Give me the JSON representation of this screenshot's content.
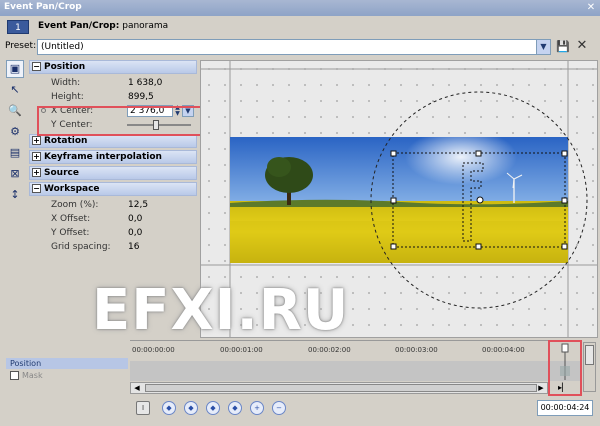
{
  "window": {
    "title": "Event Pan/Crop",
    "close_glyph": "✕"
  },
  "header": {
    "event_number": "1",
    "title_bold": "Event Pan/Crop:",
    "title_rest": "panorama"
  },
  "preset": {
    "label": "Preset:",
    "value": "(Untitled)"
  },
  "tools": [
    {
      "name": "properties-icon",
      "glyph": "▣"
    },
    {
      "name": "pointer-icon",
      "glyph": "↖"
    },
    {
      "name": "zoom-icon",
      "glyph": "🔍"
    },
    {
      "name": "normal-edit-icon",
      "glyph": "⚙"
    },
    {
      "name": "center-icon",
      "glyph": "▤"
    },
    {
      "name": "mirror-icon",
      "glyph": "⊠"
    },
    {
      "name": "move-vertical-icon",
      "glyph": "↕"
    }
  ],
  "properties": {
    "position": {
      "title": "Position",
      "width_label": "Width:",
      "width_value": "1 638,0",
      "height_label": "Height:",
      "height_value": "899,5",
      "xcenter_label": "X Center:",
      "xcenter_value": "2 376,0",
      "ycenter_label": "Y Center:",
      "ycenter_slider": 0.45
    },
    "rotation": {
      "title": "Rotation"
    },
    "keyframe": {
      "title": "Keyframe interpolation"
    },
    "source": {
      "title": "Source"
    },
    "workspace": {
      "title": "Workspace",
      "zoom_label": "Zoom (%):",
      "zoom_value": "12,5",
      "xoffset_label": "X Offset:",
      "xoffset_value": "0,0",
      "yoffset_label": "Y Offset:",
      "yoffset_value": "0,0",
      "grid_label": "Grid spacing:",
      "grid_value": "16"
    }
  },
  "canvas_overlay": {
    "frame_letter": "F"
  },
  "watermark": "EFXI.RU",
  "tracks": {
    "position": "Position",
    "mask": "Mask"
  },
  "timeline": {
    "ticks": [
      "00:00:00:00",
      "00:00:01:00",
      "00:00:02:00",
      "00:00:03:00",
      "00:00:04:00"
    ]
  },
  "time_display": "00:00:04:24",
  "colors": {
    "accent": "#3a5a9c",
    "highlight_box": "#e0505a",
    "sky": "#3f7fd3",
    "field": "#e4cf1a"
  }
}
